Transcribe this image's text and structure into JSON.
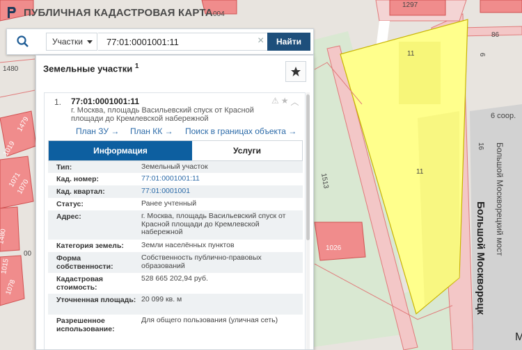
{
  "app": {
    "title": "ПУБЛИЧНАЯ КАДАСТРОВАЯ КАРТА"
  },
  "search": {
    "type_label": "Участки",
    "query": "77:01:0001001:11",
    "find_label": "Найти",
    "clear_symbol": "×"
  },
  "panel": {
    "title": "Земельные участки",
    "count": "1",
    "result": {
      "number": "1.",
      "cadastral": "77:01:0001001:11",
      "address_lines": [
        "г. Москва, площадь Васильевский спуск от Красной",
        "площади до Кремлевской набережной"
      ],
      "links": [
        "План ЗУ →",
        "План КК →",
        "Поиск в границах объекта →"
      ]
    },
    "tabs": {
      "info": "Информация",
      "services": "Услуги"
    },
    "info_rows": [
      {
        "label": "Тип:",
        "value": "Земельный участок"
      },
      {
        "label": "Кад. номер:",
        "value": "77:01:0001001:11"
      },
      {
        "label": "Кад. квартал:",
        "value": "77:01:0001001"
      },
      {
        "label": "Статус:",
        "value": "Ранее учтенный"
      },
      {
        "label": "Адрес:",
        "value": "г. Москва, площадь Васильевский спуск от Красной площади до Кремлевской набережной"
      },
      {
        "label": "Категория земель:",
        "value": "Земли населённых пунктов"
      },
      {
        "label": "Форма собственности:",
        "value": "Собственность публично-правовых образований"
      },
      {
        "label": "Кадастровая стоимость:",
        "value": "528 665 202,94 руб."
      },
      {
        "label": "Уточненная площадь:",
        "value": "20 099 кв. м"
      },
      {
        "label": "Разрешенное использование:",
        "value": "Для общего пользования (уличная сеть)"
      }
    ]
  },
  "map": {
    "labels": [
      "1297",
      "004",
      "86",
      "6",
      "11",
      "11",
      "6 соор.",
      "16",
      "Большой Москворецкий мост",
      "Большой Москворецк",
      "1513",
      "1026",
      "1480",
      "00",
      "1479",
      "1019",
      "1071",
      "1078",
      "1070",
      "1015",
      "1480",
      "М"
    ]
  },
  "colors": {
    "accent": "#1e4f7b",
    "tab_active": "#0d5fa0",
    "parcel_fill": "#ffff8c",
    "link": "#2b6aa8"
  },
  "icons": {
    "logo": "app-logo-icon",
    "search": "search-icon",
    "favorite": "star-icon"
  }
}
